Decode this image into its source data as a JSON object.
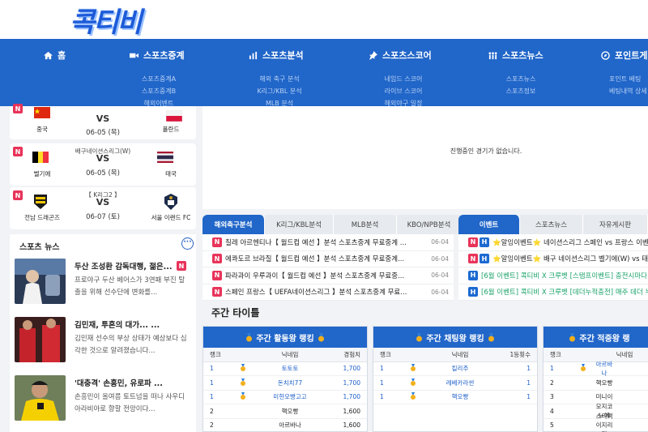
{
  "logo": {
    "text": "콕티비"
  },
  "nav": {
    "items": [
      {
        "label": "홈",
        "icon": "home-icon"
      },
      {
        "label": "스포츠중계",
        "icon": "video-icon"
      },
      {
        "label": "스포츠분석",
        "icon": "chart-icon"
      },
      {
        "label": "스포츠스코어",
        "icon": "pin-icon"
      },
      {
        "label": "스포츠뉴스",
        "icon": "people-icon"
      },
      {
        "label": "포인트게",
        "icon": "compass-icon"
      }
    ],
    "sub": [
      [
        "스포츠중계A",
        "스포츠중계B",
        "해외이벤트"
      ],
      [
        "해외 축구 분석",
        "K리그/KBL 분석",
        "MLB 분석"
      ],
      [
        "네임드 스코어",
        "라이브 스코어",
        "해외야구 일정"
      ],
      [
        "스포츠뉴스",
        "스포츠정보"
      ],
      [
        "포인트 베팅",
        "베팅내역 상세"
      ]
    ]
  },
  "matches": [
    {
      "league": "네이션스리그(W)",
      "vs": "VS",
      "date": "06-05 (목)",
      "team1": "중국",
      "team2": "폴란드"
    },
    {
      "league": "배구네이션스리그(W)",
      "vs": "VS",
      "date": "06-05 (목)",
      "team1": "벨기에",
      "team2": "태국"
    },
    {
      "league": "【 K리그2 】",
      "vs": "VS",
      "date": "06-07 (토)",
      "team1": "전남 드래곤즈",
      "team2": "서울 이랜드 FC"
    }
  ],
  "news": {
    "heading": "스포츠 뉴스",
    "more": "···",
    "items": [
      {
        "title": "두산 조성환 감독대행, 젊은...",
        "body": "프로야구 두산 베어스가 3연패 부진 탈출을 위해 선수단에 변화를..."
      },
      {
        "title": "김민재, 투혼의 대가... ...",
        "body": "김민재 선수의 부상 상태가 예상보다 심각한 것으로 알려졌습니다..."
      },
      {
        "title": "'대충격' 손흥민, 유로파 ...",
        "body": "손흥민이 올여름 토트넘을 떠나 사우디 아라비아로 향할 전망이다..."
      }
    ]
  },
  "no_game": "진행중인 경기가 없습니다.",
  "analysis_tabs": [
    "해외축구분석",
    "K리그/KBL분석",
    "MLB분석",
    "KBO/NPB분석"
  ],
  "analysis_rows": [
    {
      "text": "칠레 아르헨티나【 월드컵 예선 】분석 스포츠중계 무료중계 ...",
      "date": "06-04"
    },
    {
      "text": "에콰도르 브라질【 월드컵 예선 】분석 스포츠중계 무료중계...",
      "date": "06-04"
    },
    {
      "text": "파라과이 우루과이【 월드컵 예선 】분석 스포츠중계 무료중...",
      "date": "06-04"
    },
    {
      "text": "스페인 프랑스【 UEFA네이션스리그 】분석 스포츠중계 무료...",
      "date": "06-04"
    }
  ],
  "event_tabs": [
    "이벤트",
    "스포츠뉴스",
    "자유게시판"
  ],
  "event_rows": [
    {
      "text": "⭐알잉이벤트⭐ 네이션스리그 스페인 vs 프랑스 이벤",
      "color": "#222"
    },
    {
      "text": "⭐알잉이벤트⭐ 배구 네이션스리그 벨기에(W) vs 태국",
      "color": "#222"
    },
    {
      "text": "[6월 이벤트] 콕티비 X 크루벳 [스탬프이벤트] 충전시마다",
      "color": "#1aa36a"
    },
    {
      "text": "[6월 이벤트] 콕티비 X 크루벳 [데더누적충전] 매주 데더 누",
      "color": "#1aa36a"
    }
  ],
  "weekly_title": "주간 타이틀",
  "rank_cards": [
    {
      "title": "주간 활동왕 랭킹",
      "cols": [
        "랭크",
        "닉네임",
        "경험치"
      ],
      "rows": [
        {
          "rank": "1",
          "medal": true,
          "name": "토토토",
          "val": "1,700"
        },
        {
          "rank": "1",
          "medal": true,
          "name": "돈치치77",
          "val": "1,700"
        },
        {
          "rank": "1",
          "medal": true,
          "name": "미현오빵고고",
          "val": "1,700"
        },
        {
          "rank": "2",
          "medal": false,
          "name": "핵오빵",
          "val": "1,600"
        },
        {
          "rank": "2",
          "medal": false,
          "name": "아르바나",
          "val": "1,600"
        }
      ]
    },
    {
      "title": "주간 채팅왕 랭킹",
      "cols": [
        "랭크",
        "닉네임",
        "1등횟수"
      ],
      "rows": [
        {
          "rank": "1",
          "medal": true,
          "name": "킬리주",
          "val": "1"
        },
        {
          "rank": "1",
          "medal": true,
          "name": "레베카라썬",
          "val": "1"
        },
        {
          "rank": "1",
          "medal": true,
          "name": "핵오빵",
          "val": "1"
        }
      ]
    },
    {
      "title": "주간 적중왕 랭",
      "cols": [
        "랭크",
        "닉네임",
        ""
      ],
      "rows": [
        {
          "rank": "1",
          "medal": true,
          "name": "아르바나",
          "val": ""
        },
        {
          "rank": "2",
          "medal": false,
          "name": "핵오빵",
          "val": ""
        },
        {
          "rank": "3",
          "medal": false,
          "name": "미니이",
          "val": ""
        },
        {
          "rank": "4",
          "medal": false,
          "name": "모지코느에",
          "val": ""
        },
        {
          "rank": "5",
          "medal": false,
          "name": "스티팩이지리리",
          "val": ""
        }
      ]
    }
  ],
  "colors": {
    "primary": "#2166c9",
    "badge_new": "#e8345a",
    "badge_hot": "#1c6ad1"
  }
}
